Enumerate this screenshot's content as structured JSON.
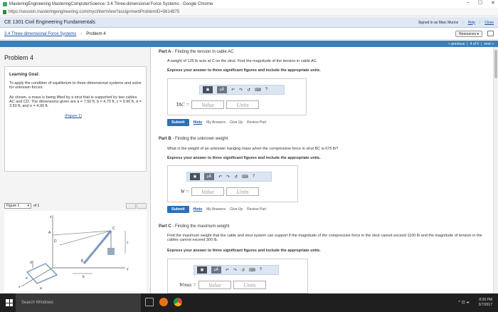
{
  "browser": {
    "title": "MasteringEngineering MasteringComputerScience: 3.4 Three-dimensional Force Systems - Google Chrome",
    "url": "https://session.masteringengineering.com/myct/itemView?assignmentProblemID=5614975",
    "controls": [
      "–",
      "☐",
      "✕"
    ]
  },
  "course": {
    "title": "CE 1301 Civil Engineering Fundamentals",
    "signed_in": "Signed in as Marc Munoz",
    "help": "Help",
    "close": "Close"
  },
  "breadcrumb": {
    "assignment": "3.4 Three-dimensional Force Systems",
    "current": "Problem 4",
    "resources": "Resources ▾"
  },
  "nav": {
    "previous": "« previous",
    "sep1": "|",
    "position": "4 of 6",
    "sep2": "|",
    "next": "next »"
  },
  "left": {
    "problem_title": "Problem 4",
    "goal_heading": "Learning Goal:",
    "goal_text": "To apply the condition of equilibrium to three-dimensional systems and solve for unknown forces.",
    "description": "As shown, a mass is being lifted by a strut that is supported by two cables AC and CD. The dimensions given are a = 7.50 ft, b = 4.70 ft, c = 9.90 ft, d = 3.50 ft, and e = 4.90 ft.",
    "figure_link": "(Figure 1)",
    "figure_select": "Figure 1",
    "figure_of": "of 1",
    "figure_labels": {
      "z": "z",
      "d": "d",
      "D": "D",
      "A": "A",
      "B": "B",
      "C": "C",
      "c": "c",
      "e": "e",
      "a": "a",
      "b": "b",
      "y": "y",
      "x": "x"
    }
  },
  "partA": {
    "heading_bold": "Part A",
    "heading_rest": " - Finding the tension in cable AC",
    "text": "A weight of 125 lb acts at C on the strut. Find the magnitude of the tension in cable AC.",
    "instr": "Express your answer to three significant figures and include the appropriate units.",
    "label": "TAC =",
    "value_ph": "Value",
    "units_ph": "Units"
  },
  "partB": {
    "heading_bold": "Part B",
    "heading_rest": " - Finding the unknown weight",
    "text": "What is the weight of an unknown hanging mass when the compressive force in strut BC is 675 lb?",
    "instr": "Express your answer to three significant figures and include the appropriate units.",
    "label": "W =",
    "value_ph": "Value",
    "units_ph": "Units"
  },
  "partC": {
    "heading_bold": "Part C",
    "heading_rest": " - Finding the maximum weight",
    "text": "Find the maximum weight that the cable and strut system can support if the magnitude of the compressive force in the strut cannot exceed 1100 lb and the magnitude of tension in the cables cannot exceed 300 lb.",
    "instr": "Express your answer to three significant figures and include the appropriate units.",
    "label": "Wmax =",
    "value_ph": "Value",
    "units_ph": "Units"
  },
  "toolbar": {
    "templates": "▣",
    "mu": "μÅ",
    "undo": "↶",
    "redo": "↷",
    "reset": "↺",
    "keyboard": "⌨",
    "help": "?"
  },
  "actions": {
    "submit": "Submit",
    "hints": "Hints",
    "my_answers": "My Answers",
    "give_up": "Give Up",
    "review": "Review Part"
  },
  "taskbar": {
    "search": "Search Windows",
    "time": "8:35 PM",
    "date": "3/7/2017",
    "tray_icons": "^ ⊡ ◂ᐧ"
  }
}
